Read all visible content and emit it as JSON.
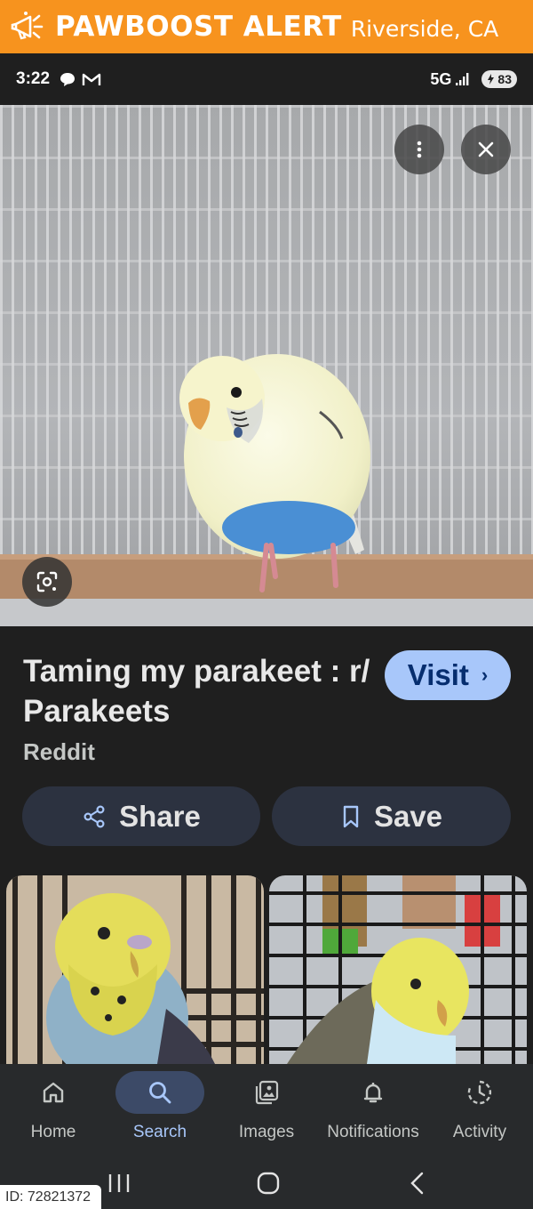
{
  "banner": {
    "brand": "PAWBOOST ALERT",
    "location": "Riverside, CA",
    "color": "#f7931e"
  },
  "status_bar": {
    "time": "3:22",
    "network": "5G",
    "battery": "83",
    "icons": [
      "message-icon",
      "gmail-icon",
      "signal-icon",
      "battery-icon"
    ]
  },
  "hero": {
    "icons": [
      "more-vert-icon",
      "close-icon",
      "lens-icon"
    ]
  },
  "result": {
    "title": "Taming my parakeet : r/ Parakeets",
    "visit_label": "Visit",
    "visit_chevron": "›",
    "source": "Reddit",
    "share_label": "Share",
    "save_label": "Save",
    "accent": "#a8c7fa"
  },
  "bottom_nav": {
    "items": [
      {
        "label": "Home",
        "icon": "home-icon"
      },
      {
        "label": "Search",
        "icon": "search-icon",
        "active": true
      },
      {
        "label": "Images",
        "icon": "images-icon"
      },
      {
        "label": "Notifications",
        "icon": "bell-icon"
      },
      {
        "label": "Activity",
        "icon": "activity-icon"
      }
    ]
  },
  "system_nav": {
    "icons": [
      "recents-icon",
      "home-circle-icon",
      "back-icon"
    ]
  },
  "id_tag": "ID: 72821372"
}
